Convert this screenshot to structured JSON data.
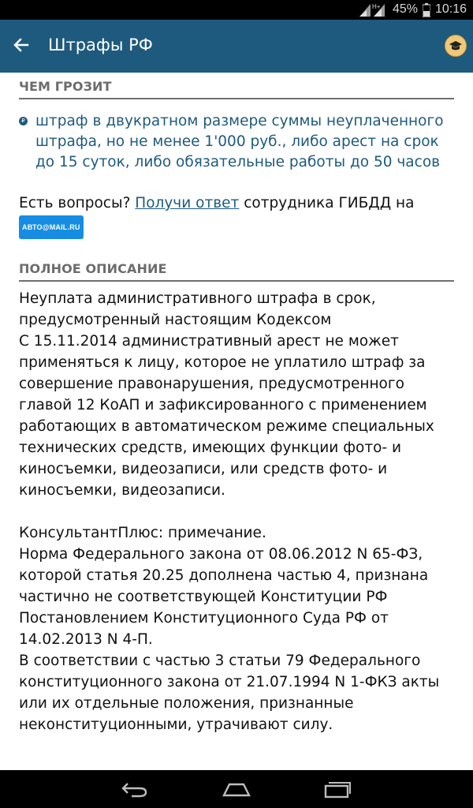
{
  "status_bar": {
    "network_type": "H+",
    "battery": "45%",
    "time": "10:16",
    "icons": [
      "signal-icon",
      "battery-icon"
    ]
  },
  "app_bar": {
    "title": "Штрафы РФ",
    "back_icon": "arrow-left-icon",
    "action_icon": "graduation-cap-icon",
    "color": "#1e5a7d"
  },
  "threat_section": {
    "header": "ЧЕМ ГРОЗИТ",
    "bullet_symbol": "₽",
    "punishment": "штраф в двукратном размере суммы неуплаченного штрафа, но не менее 1'000 руб., либо арест на срок до 15 суток, либо обязательные работы до 50 часов"
  },
  "questions": {
    "prefix": "Есть вопросы?",
    "link_text": "Получи ответ",
    "suffix": "сотрудника ГИБДД на",
    "badge_text": "АВТО@MAIL.RU"
  },
  "description_section": {
    "header": "ПОЛНОЕ ОПИСАНИЕ",
    "text": "Неуплата административного штрафа в срок, предусмотренный настоящим Кодексом\nС 15.11.2014 административный арест не может применяться к лицу, которое не уплатило штраф за совершение правонарушения, предусмотренного главой 12 КоАП и зафиксированного с применением работающих в автоматическом режиме специальных технических средств, имеющих функции фото- и киносъемки, видеозаписи, или средств фото- и киносъемки, видеозаписи.\n\nКонсультантПлюс: примечание.\nНорма Федерального закона от 08.06.2012 N 65-ФЗ, которой статья 20.25 дополнена частью 4, признана частично не соответствующей Конституции РФ Постановлением Конституционного Суда РФ от 14.02.2013 N 4-П.\nВ соответствии с частью 3 статьи 79 Федерального конституционного закона от 21.07.1994 N 1-ФКЗ акты или их отдельные положения, признанные неконституционными, утрачивают силу."
  },
  "nav_bar": {
    "icons": [
      "back-nav-icon",
      "home-nav-icon",
      "recents-nav-icon"
    ]
  }
}
